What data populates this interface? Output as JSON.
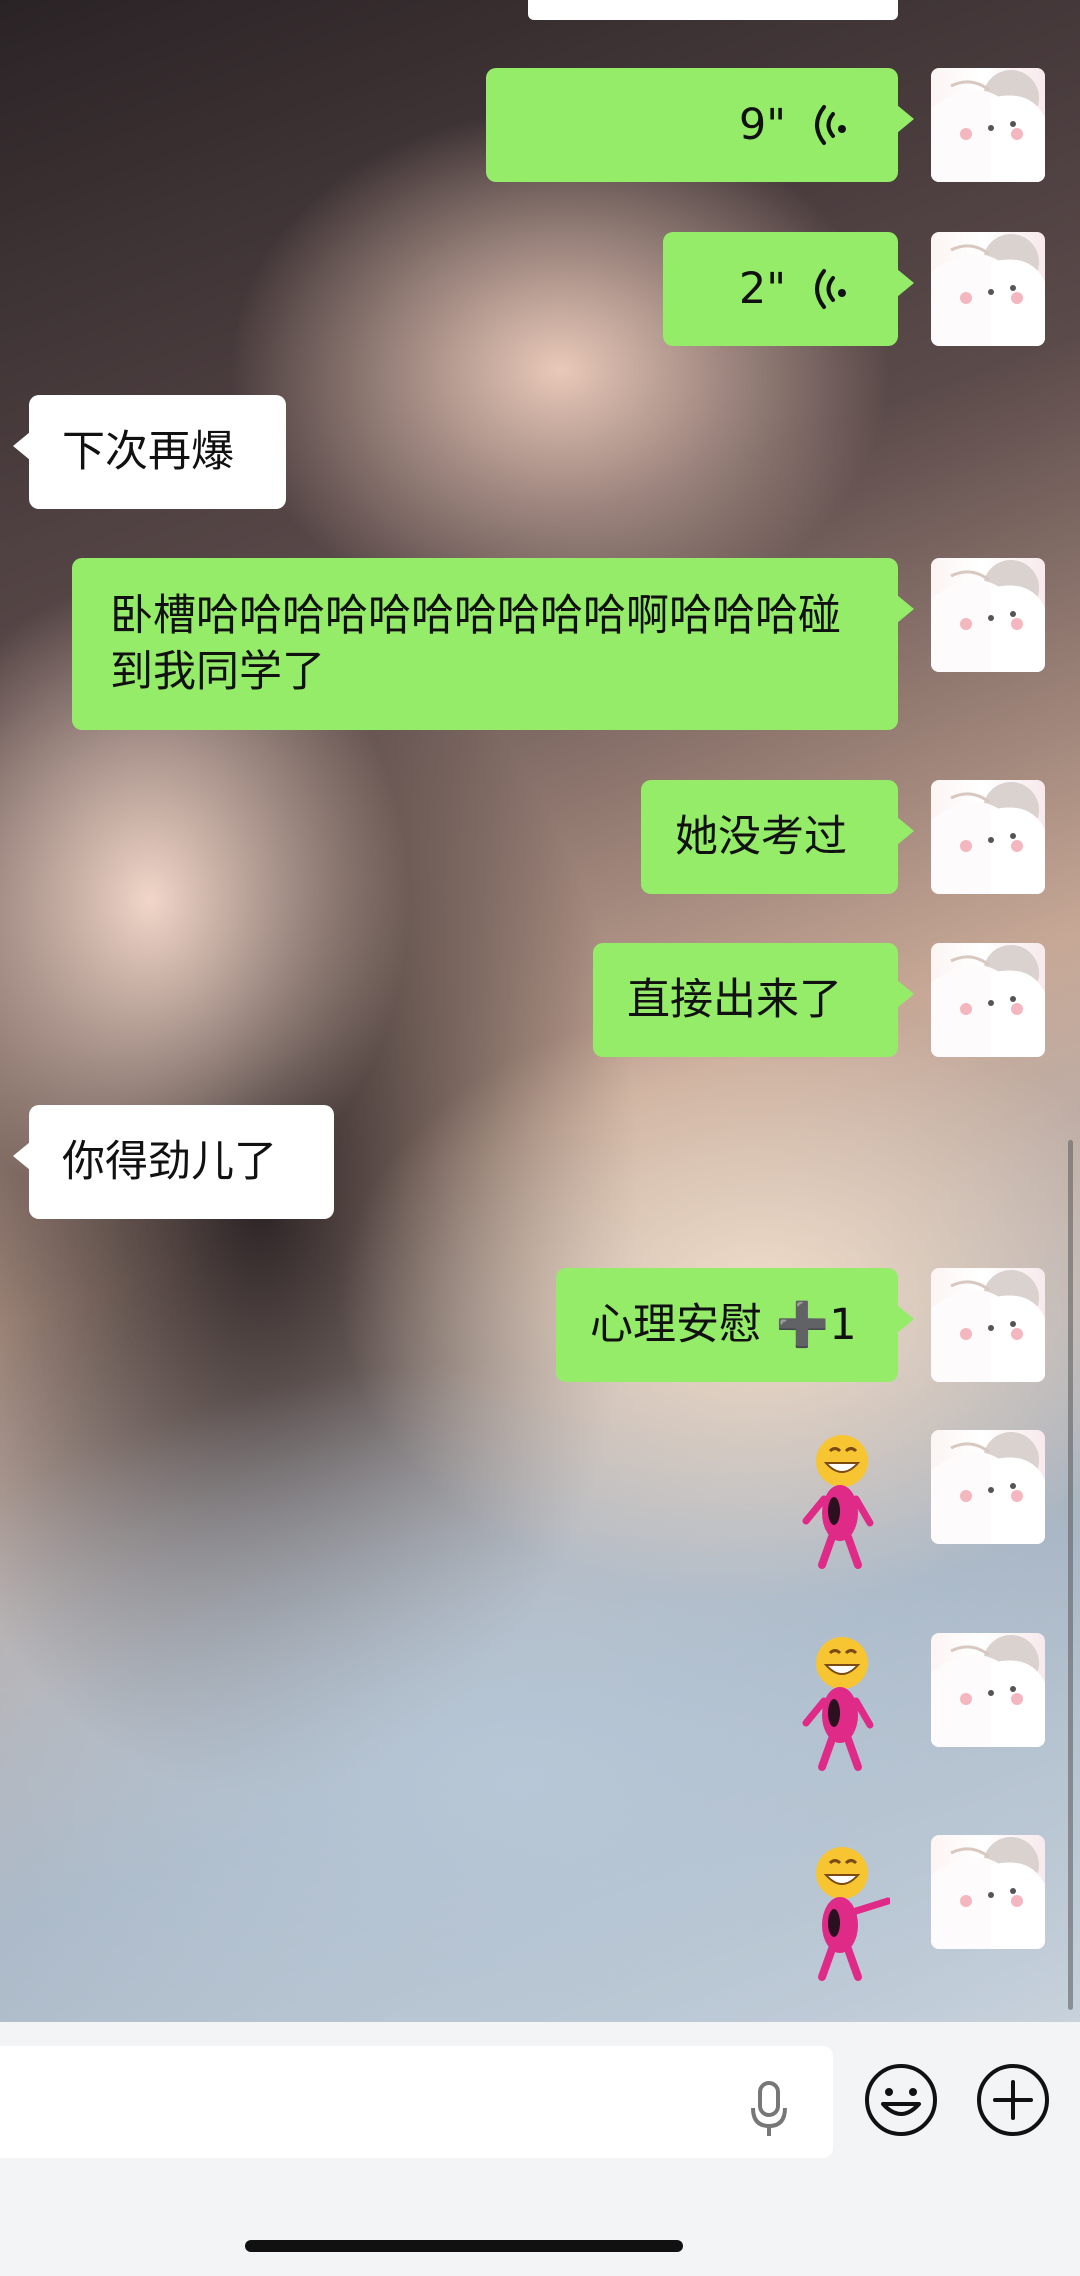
{
  "messages": [
    {
      "side": "sent",
      "type": "voice",
      "duration": "9\""
    },
    {
      "side": "sent",
      "type": "voice",
      "duration": "2\""
    },
    {
      "side": "received",
      "type": "text",
      "text": "下次再爆"
    },
    {
      "side": "sent",
      "type": "text",
      "text": "卧槽哈哈哈哈哈哈哈哈哈哈啊哈哈哈碰到我同学了"
    },
    {
      "side": "sent",
      "type": "text",
      "text": "她没考过"
    },
    {
      "side": "sent",
      "type": "text",
      "text": "直接出来了"
    },
    {
      "side": "received",
      "type": "text",
      "text": "你得劲儿了"
    },
    {
      "side": "sent",
      "type": "text",
      "text": "心理安慰 ➕1"
    },
    {
      "side": "sent",
      "type": "sticker",
      "sticker": "dancing-pink-emoji"
    },
    {
      "side": "sent",
      "type": "sticker",
      "sticker": "dancing-pink-emoji"
    },
    {
      "side": "sent",
      "type": "sticker",
      "sticker": "pointing-pink-emoji"
    }
  ],
  "input_bar": {
    "text_value": "",
    "icons": [
      "microphone-icon",
      "emoji-icon",
      "plus-icon"
    ]
  },
  "colors": {
    "sent_bubble": "#95ec69",
    "received_bubble": "#ffffff",
    "input_background": "#f3f4f5"
  }
}
